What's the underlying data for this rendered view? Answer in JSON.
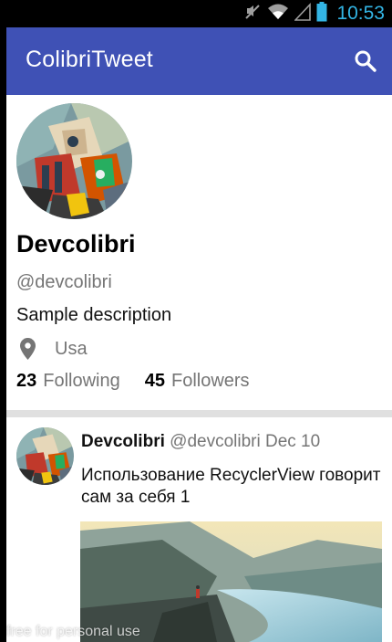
{
  "status_bar": {
    "time": "10:53",
    "icons": [
      "mute-icon",
      "wifi-icon",
      "signal-icon",
      "battery-icon"
    ],
    "color": "#33b5e5"
  },
  "app_bar": {
    "title": "ColibriTweet",
    "search_icon": "search-icon",
    "color": "#3f51b5"
  },
  "profile": {
    "name": "Devcolibri",
    "handle": "@devcolibri",
    "description": "Sample description",
    "location": "Usa",
    "location_icon": "location-pin-icon",
    "following_count": "23",
    "following_label": "Following",
    "followers_count": "45",
    "followers_label": "Followers"
  },
  "tweet": {
    "author": "Devcolibri",
    "handle": "@devcolibri",
    "date": "Dec 10",
    "text": "Использование RecyclerView говорит сам за себя 1"
  },
  "watermark": "free for personal use"
}
